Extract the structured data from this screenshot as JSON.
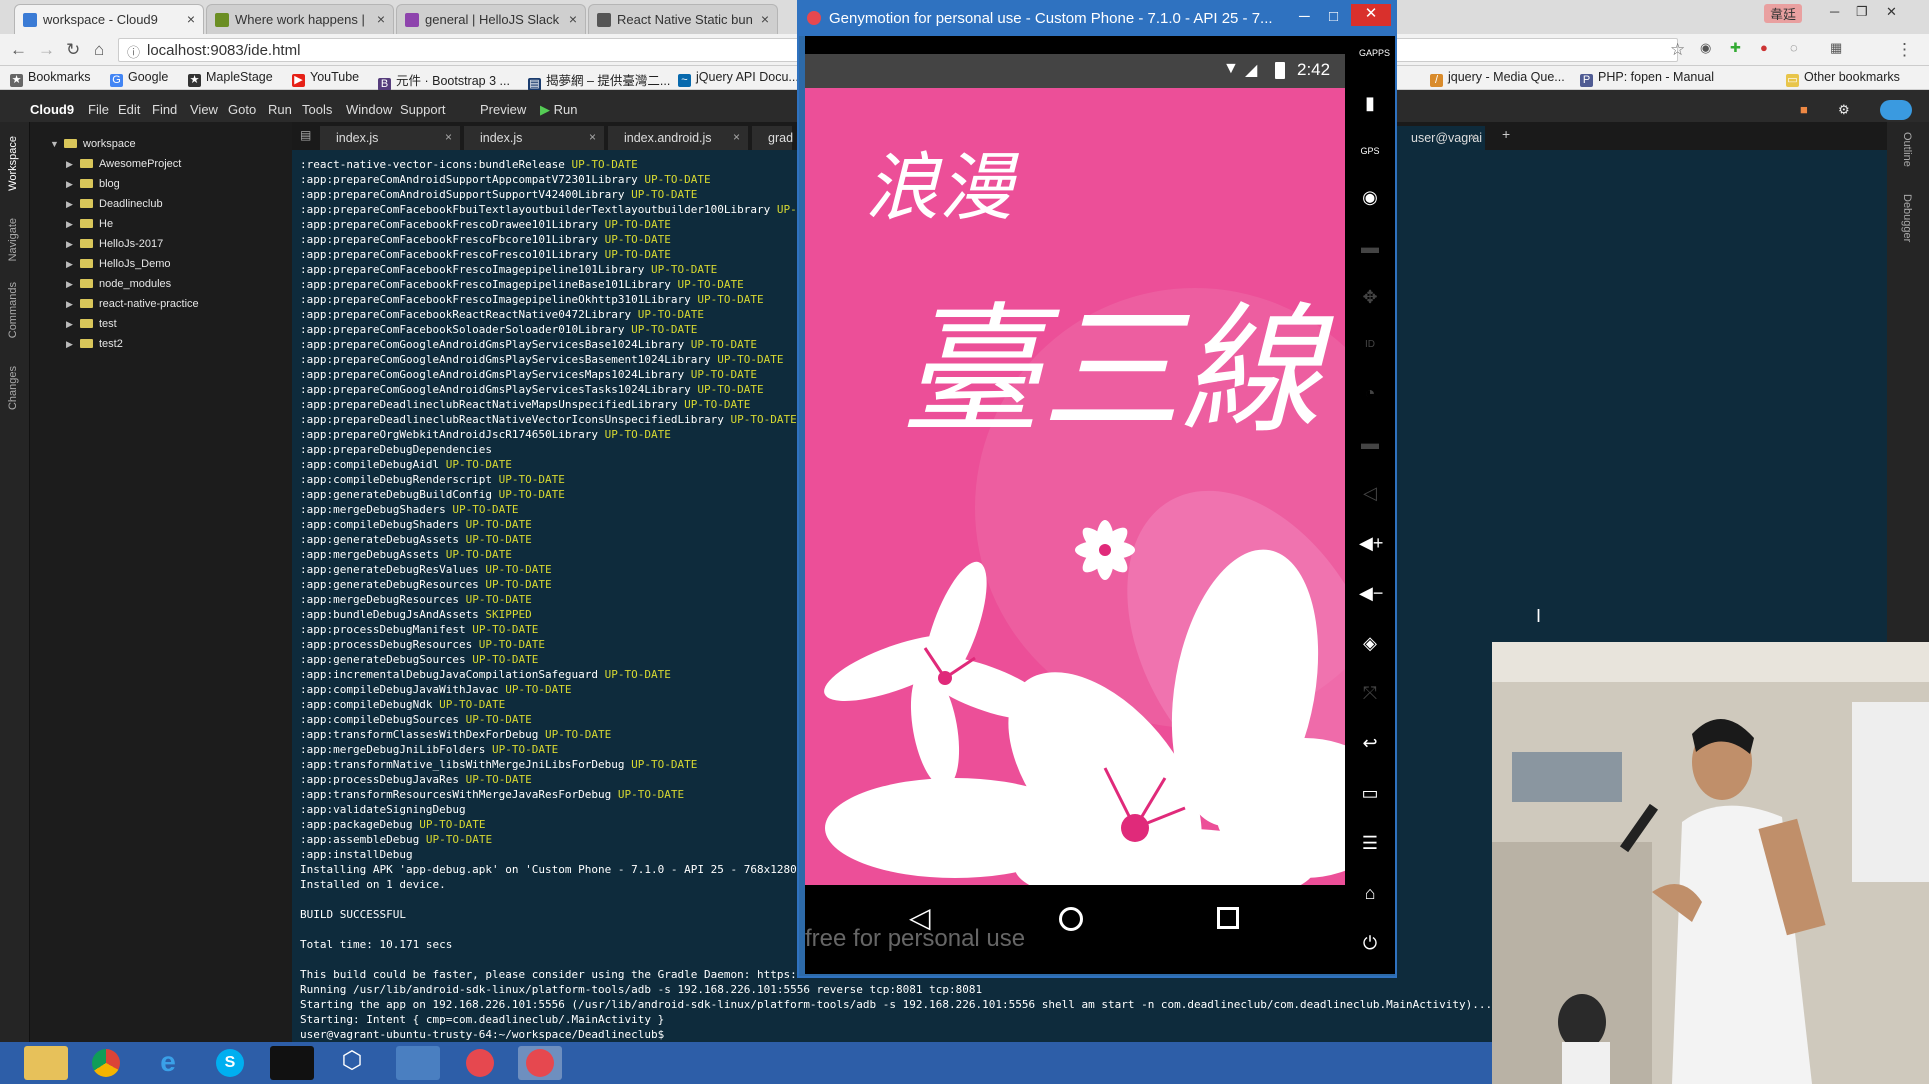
{
  "browser": {
    "tabs": [
      {
        "label": "workspace - Cloud9"
      },
      {
        "label": "Where work happens |"
      },
      {
        "label": "general | HelloJS Slack"
      },
      {
        "label": "React Native Static bun"
      }
    ],
    "window_user": "韋廷",
    "url": "localhost:9083/ide.html",
    "bookmarks": [
      "Bookmarks",
      "Google",
      "MapleStage",
      "YouTube",
      "元件 · Bootstrap 3 ...",
      "揭夢網 – 提供臺灣二...",
      "jQuery API Docu...",
      "jquery - Media Que...",
      "PHP: fopen - Manual",
      "Other bookmarks"
    ]
  },
  "c9": {
    "logo": "Cloud9",
    "menu": [
      "File",
      "Edit",
      "Find",
      "View",
      "Goto",
      "Run",
      "Tools",
      "Window",
      "Support"
    ],
    "preview": "Preview",
    "run": "Run",
    "rail": [
      "Workspace",
      "Navigate",
      "Commands",
      "Changes"
    ],
    "right_rail": [
      "Outline",
      "Debugger"
    ],
    "tree_root": "workspace",
    "tree": [
      "AwesomeProject",
      "blog",
      "Deadlineclub",
      "He",
      "HelloJs-2017",
      "HelloJs_Demo",
      "node_modules",
      "react-native-practice",
      "test",
      "test2"
    ],
    "editor_tabs": [
      "index.js",
      "index.js",
      "index.android.js",
      "grad",
      "user@vagrai"
    ]
  },
  "terminal": {
    "lines": [
      {
        "t": ":react-native-vector-icons:bundleRelease",
        "s": "UP-TO-DATE"
      },
      {
        "t": ":app:prepareComAndroidSupportAppcompatV72301Library",
        "s": "UP-TO-DATE"
      },
      {
        "t": ":app:prepareComAndroidSupportSupportV42400Library",
        "s": "UP-TO-DATE"
      },
      {
        "t": ":app:prepareComFacebookFbuiTextlayoutbuilderTextlayoutbuilder100Library",
        "s": "UP-"
      },
      {
        "t": ":app:prepareComFacebookFrescoDrawee101Library",
        "s": "UP-TO-DATE"
      },
      {
        "t": ":app:prepareComFacebookFrescoFbcore101Library",
        "s": "UP-TO-DATE"
      },
      {
        "t": ":app:prepareComFacebookFrescoFresco101Library",
        "s": "UP-TO-DATE"
      },
      {
        "t": ":app:prepareComFacebookFrescoImagepipeline101Library",
        "s": "UP-TO-DATE"
      },
      {
        "t": ":app:prepareComFacebookFrescoImagepipelineBase101Library",
        "s": "UP-TO-DATE"
      },
      {
        "t": ":app:prepareComFacebookFrescoImagepipelineOkhttp3101Library",
        "s": "UP-TO-DATE"
      },
      {
        "t": ":app:prepareComFacebookReactReactNative0472Library",
        "s": "UP-TO-DATE"
      },
      {
        "t": ":app:prepareComFacebookSoloaderSoloader010Library",
        "s": "UP-TO-DATE"
      },
      {
        "t": ":app:prepareComGoogleAndroidGmsPlayServicesBase1024Library",
        "s": "UP-TO-DATE"
      },
      {
        "t": ":app:prepareComGoogleAndroidGmsPlayServicesBasement1024Library",
        "s": "UP-TO-DATE"
      },
      {
        "t": ":app:prepareComGoogleAndroidGmsPlayServicesMaps1024Library",
        "s": "UP-TO-DATE"
      },
      {
        "t": ":app:prepareComGoogleAndroidGmsPlayServicesTasks1024Library",
        "s": "UP-TO-DATE"
      },
      {
        "t": ":app:prepareDeadlineclubReactNativeMapsUnspecifiedLibrary",
        "s": "UP-TO-DATE"
      },
      {
        "t": ":app:prepareDeadlineclubReactNativeVectorIconsUnspecifiedLibrary",
        "s": "UP-TO-DATE"
      },
      {
        "t": ":app:prepareOrgWebkitAndroidJscR174650Library",
        "s": "UP-TO-DATE"
      },
      {
        "t": ":app:prepareDebugDependencies",
        "s": ""
      },
      {
        "t": ":app:compileDebugAidl",
        "s": "UP-TO-DATE"
      },
      {
        "t": ":app:compileDebugRenderscript",
        "s": "UP-TO-DATE"
      },
      {
        "t": ":app:generateDebugBuildConfig",
        "s": "UP-TO-DATE"
      },
      {
        "t": ":app:mergeDebugShaders",
        "s": "UP-TO-DATE"
      },
      {
        "t": ":app:compileDebugShaders",
        "s": "UP-TO-DATE"
      },
      {
        "t": ":app:generateDebugAssets",
        "s": "UP-TO-DATE"
      },
      {
        "t": ":app:mergeDebugAssets",
        "s": "UP-TO-DATE"
      },
      {
        "t": ":app:generateDebugResValues",
        "s": "UP-TO-DATE"
      },
      {
        "t": ":app:generateDebugResources",
        "s": "UP-TO-DATE"
      },
      {
        "t": ":app:mergeDebugResources",
        "s": "UP-TO-DATE"
      },
      {
        "t": ":app:bundleDebugJsAndAssets",
        "s": "SKIPPED"
      },
      {
        "t": ":app:processDebugManifest",
        "s": "UP-TO-DATE"
      },
      {
        "t": ":app:processDebugResources",
        "s": "UP-TO-DATE"
      },
      {
        "t": ":app:generateDebugSources",
        "s": "UP-TO-DATE"
      },
      {
        "t": ":app:incrementalDebugJavaCompilationSafeguard",
        "s": "UP-TO-DATE"
      },
      {
        "t": ":app:compileDebugJavaWithJavac",
        "s": "UP-TO-DATE"
      },
      {
        "t": ":app:compileDebugNdk",
        "s": "UP-TO-DATE"
      },
      {
        "t": ":app:compileDebugSources",
        "s": "UP-TO-DATE"
      },
      {
        "t": ":app:transformClassesWithDexForDebug",
        "s": "UP-TO-DATE"
      },
      {
        "t": ":app:mergeDebugJniLibFolders",
        "s": "UP-TO-DATE"
      },
      {
        "t": ":app:transformNative_libsWithMergeJniLibsForDebug",
        "s": "UP-TO-DATE"
      },
      {
        "t": ":app:processDebugJavaRes",
        "s": "UP-TO-DATE"
      },
      {
        "t": ":app:transformResourcesWithMergeJavaResForDebug",
        "s": "UP-TO-DATE"
      },
      {
        "t": ":app:validateSigningDebug",
        "s": ""
      },
      {
        "t": ":app:packageDebug",
        "s": "UP-TO-DATE"
      },
      {
        "t": ":app:assembleDebug",
        "s": "UP-TO-DATE"
      },
      {
        "t": ":app:installDebug",
        "s": ""
      },
      {
        "t": "Installing APK 'app-debug.apk' on 'Custom Phone - 7.1.0 - API 25 - 768x1280",
        "s": ""
      },
      {
        "t": "Installed on 1 device.",
        "s": ""
      },
      {
        "t": "",
        "s": ""
      },
      {
        "t": "BUILD SUCCESSFUL",
        "s": ""
      },
      {
        "t": "",
        "s": ""
      },
      {
        "t": "Total time: 10.171 secs",
        "s": ""
      },
      {
        "t": "",
        "s": ""
      },
      {
        "t": "This build could be faster, please consider using the Gradle Daemon: https:",
        "s": ""
      },
      {
        "t": "Running /usr/lib/android-sdk-linux/platform-tools/adb -s 192.168.226.101:5556 reverse tcp:8081 tcp:8081",
        "s": ""
      },
      {
        "t": "Starting the app on 192.168.226.101:5556 (/usr/lib/android-sdk-linux/platform-tools/adb -s 192.168.226.101:5556 shell am start -n com.deadlineclub/com.deadlineclub.MainActivity)...",
        "s": ""
      },
      {
        "t": "Starting: Intent { cmp=com.deadlineclub/.MainActivity }",
        "s": ""
      },
      {
        "t": "user@vagrant-ubuntu-trusty-64:~/workspace/Deadlineclub$",
        "s": ""
      }
    ]
  },
  "genymotion": {
    "title": "Genymotion for personal use - Custom Phone - 7.1.0 - API 25 - 7...",
    "clock": "2:42",
    "app_title_small": "浪漫",
    "app_title_big": "臺三線",
    "watermark": "free for personal use",
    "side_labels": [
      "GAPPS",
      "GPS",
      "ID"
    ]
  },
  "colors": {
    "app_pink": "#ec4f98",
    "terminal_bg": "#0e2b3c",
    "uptodate": "#d6d832",
    "geny_blue": "#2f72c0"
  }
}
